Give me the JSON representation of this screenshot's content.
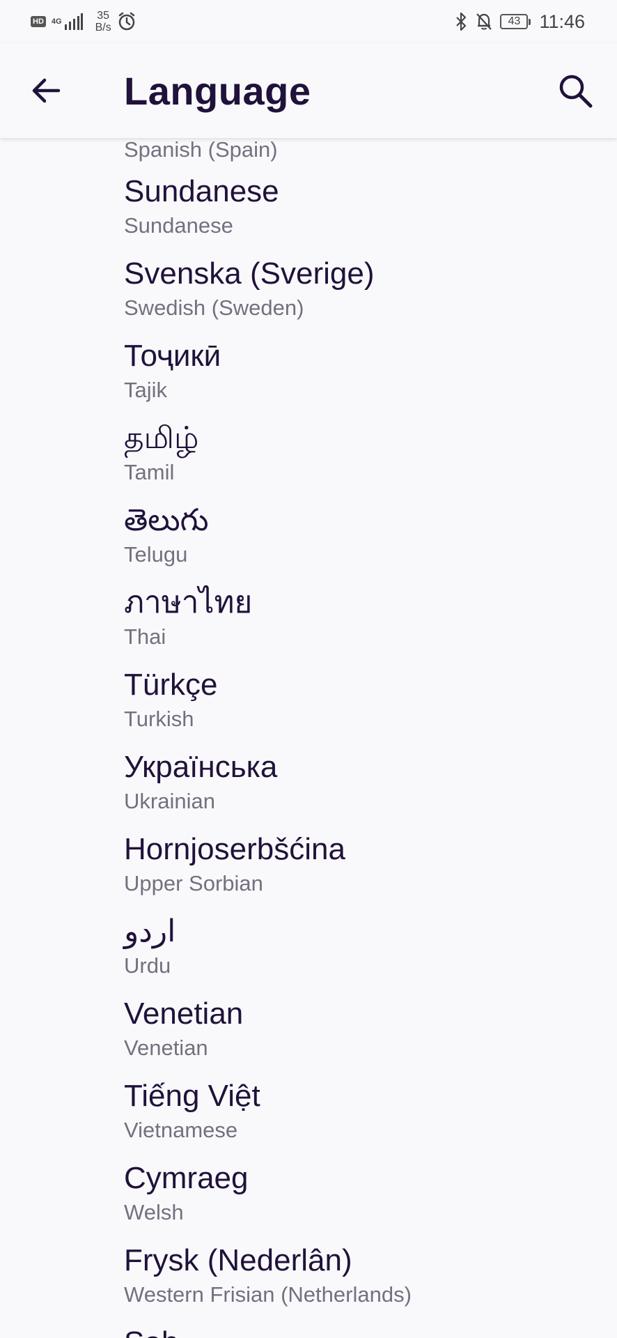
{
  "status_bar": {
    "hd": "HD",
    "network": "4G",
    "speed_value": "35",
    "speed_unit": "B/s",
    "battery": "43",
    "time": "11:46"
  },
  "app_bar": {
    "title": "Language",
    "back_icon": "arrow-left-icon",
    "search_icon": "search-icon"
  },
  "languages": {
    "partial_top": "Spanish (Spain)",
    "items": [
      {
        "native": "Sundanese",
        "english": "Sundanese"
      },
      {
        "native": "Svenska (Sverige)",
        "english": "Swedish (Sweden)"
      },
      {
        "native": "Тоҷикӣ",
        "english": "Tajik"
      },
      {
        "native": "தமிழ்",
        "english": "Tamil"
      },
      {
        "native": "తెలుగు",
        "english": "Telugu"
      },
      {
        "native": "ภาษาไทย",
        "english": "Thai"
      },
      {
        "native": "Türkçe",
        "english": "Turkish"
      },
      {
        "native": "Українська",
        "english": "Ukrainian"
      },
      {
        "native": "Hornjoserbšćina",
        "english": "Upper Sorbian"
      },
      {
        "native": "اردو",
        "english": "Urdu"
      },
      {
        "native": "Venetian",
        "english": "Venetian"
      },
      {
        "native": "Tiếng Việt",
        "english": "Vietnamese"
      },
      {
        "native": "Cymraeg",
        "english": "Welsh"
      },
      {
        "native": "Frysk (Nederlân)",
        "english": "Western Frisian (Netherlands)"
      }
    ],
    "partial_bottom": "Sah"
  }
}
